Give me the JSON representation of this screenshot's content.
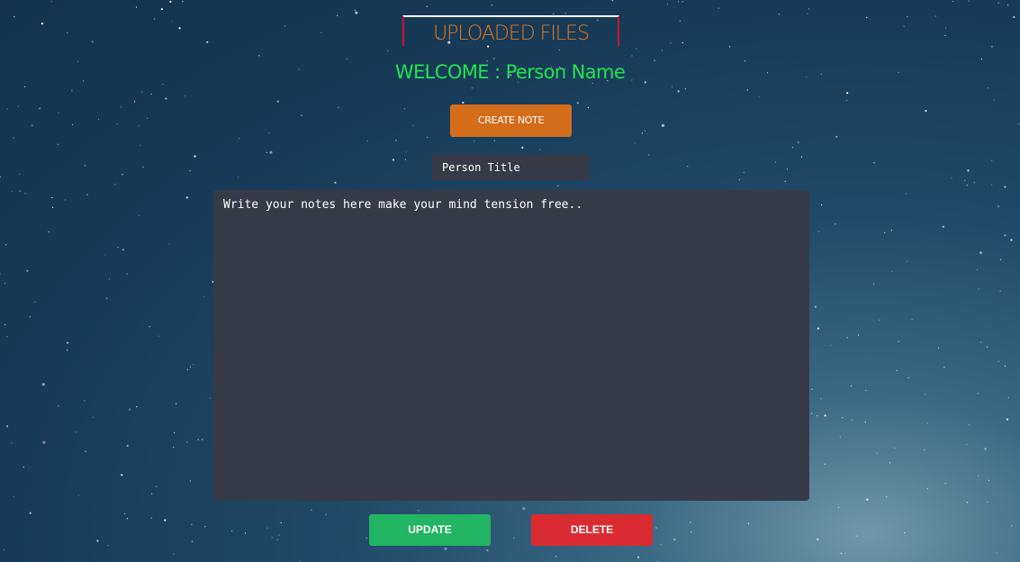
{
  "header": {
    "title": "UPLOADED FILES",
    "welcome": "WELCOME : Person Name"
  },
  "actions": {
    "create_note_label": "CREATE NOTE",
    "update_label": "UPDATE",
    "delete_label": "DELETE"
  },
  "note": {
    "title_value": "Person Title",
    "body_value": "Write your notes here make your mind tension free.."
  },
  "colors": {
    "title": "#e2761f",
    "welcome": "#22e34d",
    "create_button": "#d46d19",
    "update_button": "#22b563",
    "delete_button": "#da2b32",
    "field_background": "#373b47"
  }
}
